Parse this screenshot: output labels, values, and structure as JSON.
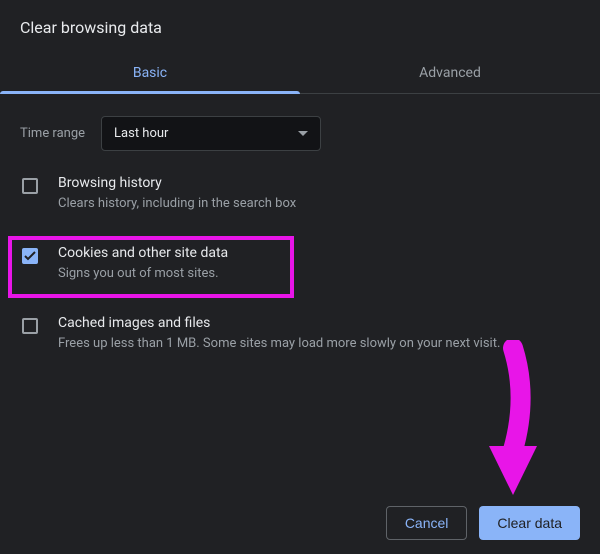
{
  "title": "Clear browsing data",
  "tabs": {
    "basic": "Basic",
    "advanced": "Advanced"
  },
  "time_range": {
    "label": "Time range",
    "value": "Last hour"
  },
  "options": [
    {
      "checked": false,
      "title": "Browsing history",
      "desc": "Clears history, including in the search box"
    },
    {
      "checked": true,
      "title": "Cookies and other site data",
      "desc": "Signs you out of most sites."
    },
    {
      "checked": false,
      "title": "Cached images and files",
      "desc": "Frees up less than 1 MB. Some sites may load more slowly on your next visit."
    }
  ],
  "buttons": {
    "cancel": "Cancel",
    "clear": "Clear data"
  },
  "annotation": {
    "highlight_color": "#e815e8",
    "arrow_color": "#e815e8"
  }
}
